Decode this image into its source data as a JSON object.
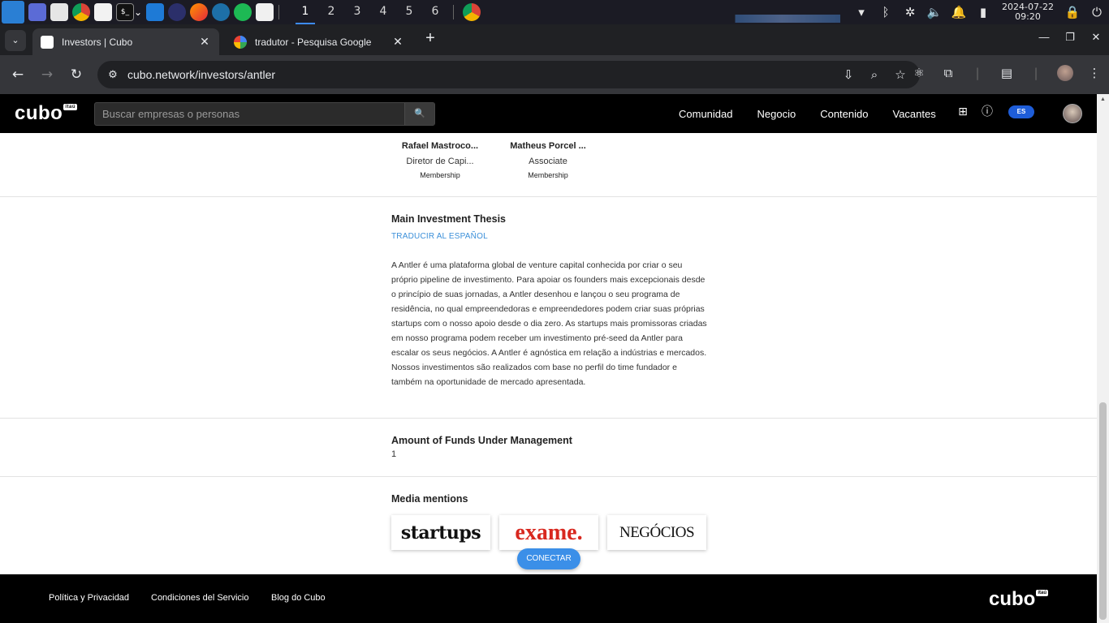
{
  "os": {
    "workspaces": [
      "1",
      "2",
      "3",
      "4",
      "5",
      "6"
    ],
    "active_workspace": "1",
    "clock": {
      "date": "2024-07-22",
      "time": "09:20"
    }
  },
  "browser": {
    "tabs": [
      {
        "title": "Investors | Cubo",
        "active": true
      },
      {
        "title": "tradutor - Pesquisa Google",
        "active": false
      }
    ],
    "url": "cubo.network/investors/antler"
  },
  "site": {
    "logo": "cubo",
    "logo_badge": "itaú",
    "search_placeholder": "Buscar empresas o personas",
    "nav": [
      "Comunidad",
      "Negocio",
      "Contenido",
      "Vacantes"
    ],
    "lang": "ES"
  },
  "people": [
    {
      "name": "Rafael Mastroco...",
      "role": "Diretor de Capi...",
      "badge": "Membership"
    },
    {
      "name": "Matheus Porcel ...",
      "role": "Associate",
      "badge": "Membership"
    }
  ],
  "thesis": {
    "title": "Main Investment Thesis",
    "translate_link": "TRADUCIR AL ESPAÑOL",
    "body": "A Antler é uma plataforma global de venture capital conhecida por criar o seu próprio pipeline de investimento. Para apoiar os founders mais excepcionais desde o princípio de suas jornadas, a Antler desenhou e lançou o seu programa de residência, no qual empreendedoras e empreendedores podem criar suas próprias startups com o nosso apoio desde o dia zero. As startups mais promissoras criadas em nosso programa podem receber um investimento pré-seed da Antler para escalar os seus negócios. A Antler é agnóstica em relação a indústrias e mercados. Nossos investimentos são realizados com base no perfil do time fundador e também na oportunidade de mercado apresentada."
  },
  "funds": {
    "title": "Amount of Funds Under Management",
    "value": "1"
  },
  "media": {
    "title": "Media mentions",
    "logos": [
      "startups",
      "exame.",
      "NEGÓCIOS"
    ]
  },
  "connect_button": "CONECTAR",
  "footer": {
    "links": [
      "Política y Privacidad",
      "Condiciones del Servicio",
      "Blog do Cubo"
    ],
    "logo": "cubo",
    "logo_badge": "itaú"
  },
  "colors": {
    "accent": "#3b8fe8",
    "link": "#3b8fd9",
    "lang_badge": "#1e5dd8",
    "header_bg": "#000000"
  }
}
